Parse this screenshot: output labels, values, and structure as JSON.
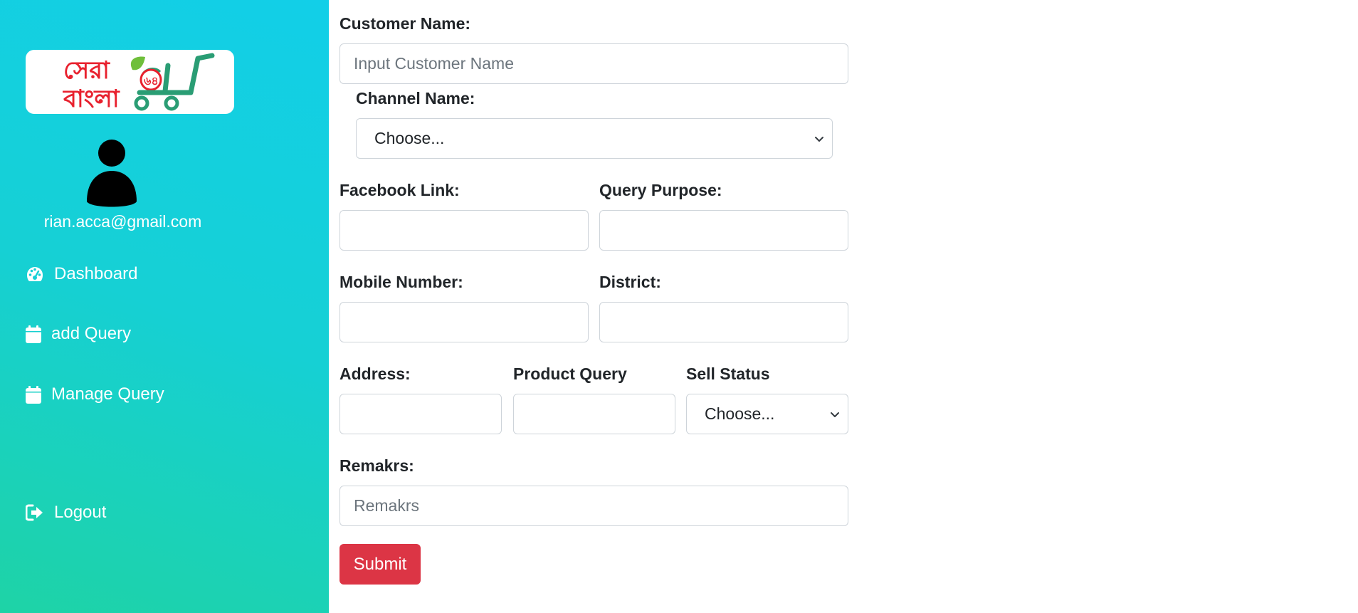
{
  "sidebar": {
    "user_email": "rian.acca@gmail.com",
    "logo": {
      "line1": "সেরা",
      "line2": "বাংলা",
      "badge": "৬৪"
    },
    "nav": {
      "dashboard": "Dashboard",
      "add_query": "add Query",
      "manage_query": "Manage Query",
      "logout": "Logout"
    }
  },
  "form": {
    "customer_name": {
      "label": "Customer Name:",
      "placeholder": "Input Customer Name"
    },
    "channel_name": {
      "label": "Channel Name:",
      "selected": "Choose..."
    },
    "facebook_link": {
      "label": "Facebook Link:"
    },
    "query_purpose": {
      "label": "Query Purpose:"
    },
    "mobile_number": {
      "label": "Mobile Number:"
    },
    "district": {
      "label": "District:"
    },
    "address": {
      "label": "Address:"
    },
    "product_query": {
      "label": "Product Query"
    },
    "sell_status": {
      "label": "Sell Status",
      "selected": "Choose..."
    },
    "remarks": {
      "label": "Remakrs:",
      "placeholder": "Remakrs"
    },
    "submit_label": "Submit"
  },
  "colors": {
    "sidebar_gradient_top": "#12cfe8",
    "sidebar_gradient_bottom": "#1ed3a6",
    "submit": "#dc3545",
    "logo_red": "#e8212e",
    "logo_green": "#2a9d74"
  }
}
